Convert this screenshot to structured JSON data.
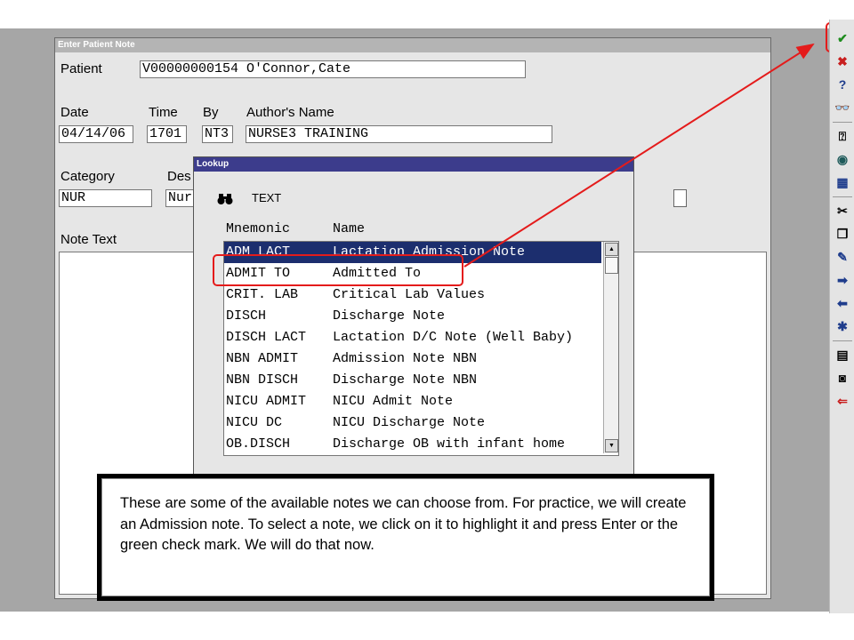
{
  "window": {
    "title": "Enter Patient Note",
    "patient_label": "Patient",
    "patient_value": "V00000000154 O'Connor,Cate",
    "date_label": "Date",
    "date_value": "04/14/06",
    "time_label": "Time",
    "time_value": "1701",
    "by_label": "By",
    "by_value": "NT3",
    "author_label": "Author's Name",
    "author_value": "NURSE3 TRAINING",
    "category_label": "Category",
    "category_value": "NUR",
    "desc_label": "Des",
    "desc_value": "Nur",
    "note_text_label": "Note Text"
  },
  "lookup": {
    "title": "Lookup",
    "search_label": "TEXT",
    "col_mnemonic": "Mnemonic",
    "col_name": "Name",
    "rows": [
      {
        "mnemonic": "ADM LACT",
        "name": "Lactation Admission Note"
      },
      {
        "mnemonic": "ADMIT TO",
        "name": "Admitted To"
      },
      {
        "mnemonic": "CRIT. LAB",
        "name": "Critical Lab Values"
      },
      {
        "mnemonic": "DISCH",
        "name": "Discharge Note"
      },
      {
        "mnemonic": "DISCH LACT",
        "name": "Lactation D/C Note (Well Baby)"
      },
      {
        "mnemonic": "NBN ADMIT",
        "name": "Admission Note NBN"
      },
      {
        "mnemonic": "NBN DISCH",
        "name": "Discharge Note NBN"
      },
      {
        "mnemonic": "NICU ADMIT",
        "name": "NICU Admit Note"
      },
      {
        "mnemonic": "NICU DC",
        "name": "NICU Discharge Note"
      },
      {
        "mnemonic": "OB.DISCH",
        "name": "Discharge OB with infant home"
      }
    ],
    "selected_index": 0
  },
  "callout": {
    "text": "These are some of the available notes we can choose from. For practice, we will create an Admission note. To select a note, we click on it to highlight it and press Enter or the green check mark. We will do that now."
  },
  "toolbar": {
    "items": [
      {
        "icon": "check-icon",
        "glyph": "✔",
        "color": "#1e8c1e"
      },
      {
        "icon": "cancel-icon",
        "glyph": "✖",
        "color": "#c81e1e"
      },
      {
        "icon": "help-icon",
        "glyph": "?",
        "color": "#1e3c8c"
      },
      {
        "icon": "binoculars-icon",
        "glyph": "👓",
        "color": "#000000"
      },
      {
        "icon": "form-help-icon",
        "glyph": "⍰",
        "color": "#000000"
      },
      {
        "icon": "globe-icon",
        "glyph": "◉",
        "color": "#1e5a5a"
      },
      {
        "icon": "calculator-icon",
        "glyph": "▦",
        "color": "#1e3c8c"
      },
      {
        "icon": "scissors-icon",
        "glyph": "✂",
        "color": "#000000"
      },
      {
        "icon": "copy-icon",
        "glyph": "❐",
        "color": "#000000"
      },
      {
        "icon": "paste-icon",
        "glyph": "✎",
        "color": "#1e3c8c"
      },
      {
        "icon": "arrow-right-icon",
        "glyph": "➡",
        "color": "#1e3c8c"
      },
      {
        "icon": "arrow-left-icon",
        "glyph": "⬅",
        "color": "#1e3c8c"
      },
      {
        "icon": "asterisk-icon",
        "glyph": "✱",
        "color": "#1e3c8c"
      },
      {
        "icon": "keyboard-icon",
        "glyph": "▤",
        "color": "#000000"
      },
      {
        "icon": "camera-icon",
        "glyph": "◙",
        "color": "#000000"
      },
      {
        "icon": "exit-icon",
        "glyph": "⇐",
        "color": "#c81e1e"
      }
    ]
  },
  "colors": {
    "selection": "#1c2e6e",
    "annotation_red": "#e41b1b",
    "lookup_title_bar": "#3c3c8c"
  }
}
